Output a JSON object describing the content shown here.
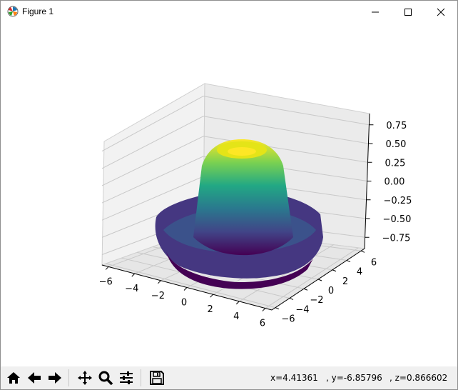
{
  "window": {
    "title": "Figure 1",
    "app_icon": "matplotlib-icon",
    "controls": [
      "minimize-icon",
      "maximize-icon",
      "close-icon"
    ]
  },
  "toolbar": {
    "buttons": [
      "home-icon",
      "back-arrow-icon",
      "forward-arrow-icon",
      "pan-icon",
      "zoom-icon",
      "configure-subplots-icon",
      "save-icon"
    ]
  },
  "status": {
    "x": "x=4.41361",
    "y": ", y=-6.85796",
    "z": ", z=0.866602"
  },
  "chart_data": {
    "type": "surface-3d",
    "colormap": "viridis",
    "x_ticks": [
      "−6",
      "−4",
      "−2",
      "0",
      "2",
      "4",
      "6"
    ],
    "y_ticks": [
      "−6",
      "−4",
      "−2",
      "0",
      "2",
      "4",
      "6"
    ],
    "z_ticks": [
      "0.75",
      "0.50",
      "0.25",
      "0.00",
      "−0.25",
      "−0.50",
      "−0.75"
    ],
    "xlim": [
      -6.5,
      6.5
    ],
    "ylim": [
      -6.5,
      6.5
    ],
    "zlim": [
      -0.9,
      0.9
    ],
    "grid": true
  }
}
